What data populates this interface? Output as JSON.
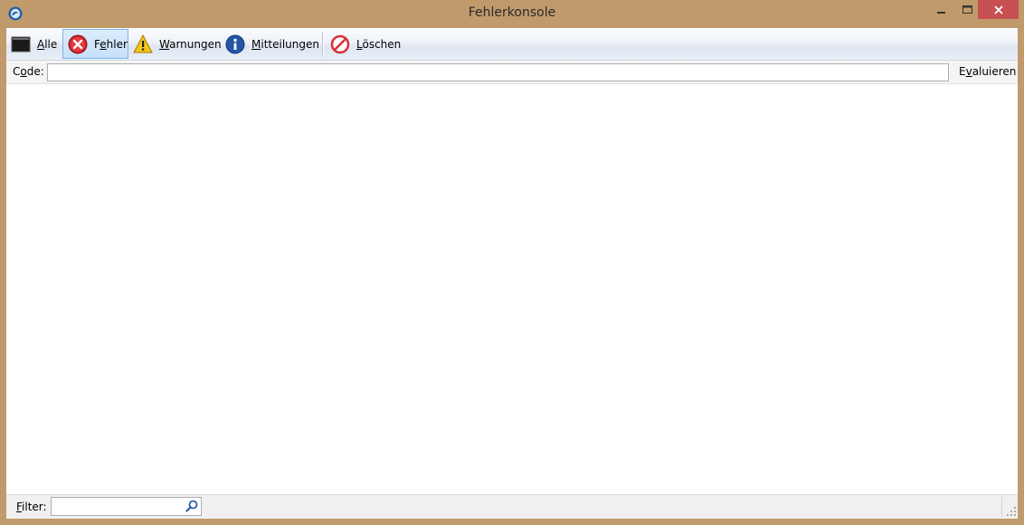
{
  "window": {
    "title": "Fehlerkonsole",
    "close_color": "#c75050",
    "frame_color": "#c19a6b"
  },
  "toolbar": {
    "buttons": [
      {
        "label_accel": "A",
        "label_rest": "lle",
        "icon": "console-icon",
        "active": false
      },
      {
        "label_pre": "F",
        "label_accel": "e",
        "label_rest": "hler",
        "icon": "error-icon",
        "active": true
      },
      {
        "label_accel": "W",
        "label_rest": "arnungen",
        "icon": "warning-icon",
        "active": false
      },
      {
        "label_accel": "M",
        "label_rest": "itteilungen",
        "icon": "info-icon",
        "active": false
      },
      {
        "label_accel": "L",
        "label_rest": "öschen",
        "icon": "clear-icon",
        "active": false
      }
    ]
  },
  "codebar": {
    "label_pre": "C",
    "label_accel": "o",
    "label_rest": "de:",
    "value": "",
    "evaluate_accel": "v",
    "evaluate_pre": "E",
    "evaluate_rest": "aluieren"
  },
  "statusbar": {
    "filter_accel": "F",
    "filter_rest": "ilter:",
    "filter_value": ""
  }
}
